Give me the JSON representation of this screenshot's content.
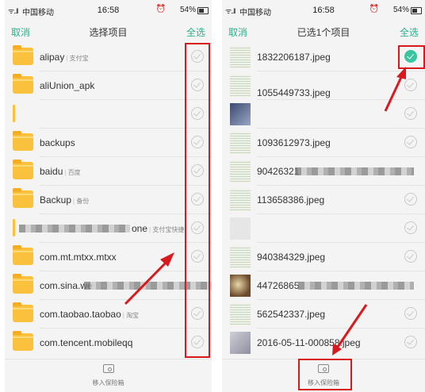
{
  "status_bar": {
    "signal": "ᯤ..ll",
    "carrier": "中国移动",
    "time": "16:58",
    "alarm": "⏰",
    "battery": "54%"
  },
  "left": {
    "nav": {
      "cancel": "取消",
      "title": "选择项目",
      "select_all": "全选"
    },
    "rows": [
      {
        "icon": "folder",
        "label": "alipay",
        "sub": "支付宝",
        "checked": false
      },
      {
        "icon": "folder",
        "label": "aliUnion_apk",
        "sub": "",
        "checked": false
      },
      {
        "icon": "slim",
        "label": "",
        "sub": "",
        "checked": false
      },
      {
        "icon": "folder",
        "label": "backups",
        "sub": "",
        "checked": false
      },
      {
        "icon": "folder",
        "label": "baidu",
        "sub": "百度",
        "checked": false
      },
      {
        "icon": "folder",
        "label": "Backup",
        "sub": "备份",
        "checked": false
      },
      {
        "icon": "slim",
        "label": "one",
        "sub": "支付宝快捷",
        "checked": false
      },
      {
        "icon": "folder",
        "label": "com.mt.mtxx.mtxx",
        "sub": "",
        "checked": false
      },
      {
        "icon": "folder",
        "label": "com.sina.we",
        "sub": "",
        "checked": false
      },
      {
        "icon": "folder",
        "label": "com.taobao.taobao",
        "sub": "淘宝",
        "checked": false
      },
      {
        "icon": "folder",
        "label": "com.tencent.mobileqq",
        "sub": "",
        "checked": false
      }
    ],
    "bottom": {
      "label": "移入保险箱"
    }
  },
  "right": {
    "nav": {
      "cancel": "取消",
      "title": "已选1个项目",
      "select_all": "全选"
    },
    "rows": [
      {
        "thumb": "doc",
        "label": "1832206187.jpeg",
        "checked": true
      },
      {
        "thumb": "doc",
        "label": "1055449733.jpeg",
        "checked": false
      },
      {
        "thumb": "dark",
        "label": "",
        "checked": false
      },
      {
        "thumb": "doc",
        "label": "1093612973.jpeg",
        "checked": false
      },
      {
        "thumb": "doc",
        "label": "90426321",
        "checked": false
      },
      {
        "thumb": "doc",
        "label": "113658386.jpeg",
        "checked": false
      },
      {
        "thumb": "blank",
        "label": "",
        "checked": false
      },
      {
        "thumb": "doc",
        "label": "940384329.jpeg",
        "checked": false
      },
      {
        "thumb": "photo",
        "label": "44726865",
        "checked": false
      },
      {
        "thumb": "doc",
        "label": "562542337.jpeg",
        "checked": false
      },
      {
        "thumb": "blur",
        "label": "2016-05-11-000858.jpeg",
        "checked": false
      }
    ],
    "bottom": {
      "label": "移入保险箱"
    }
  },
  "colors": {
    "accent": "#2fae8e",
    "checked": "#39c5a1",
    "folder": "#f9c13c",
    "highlight": "#d8191e"
  }
}
